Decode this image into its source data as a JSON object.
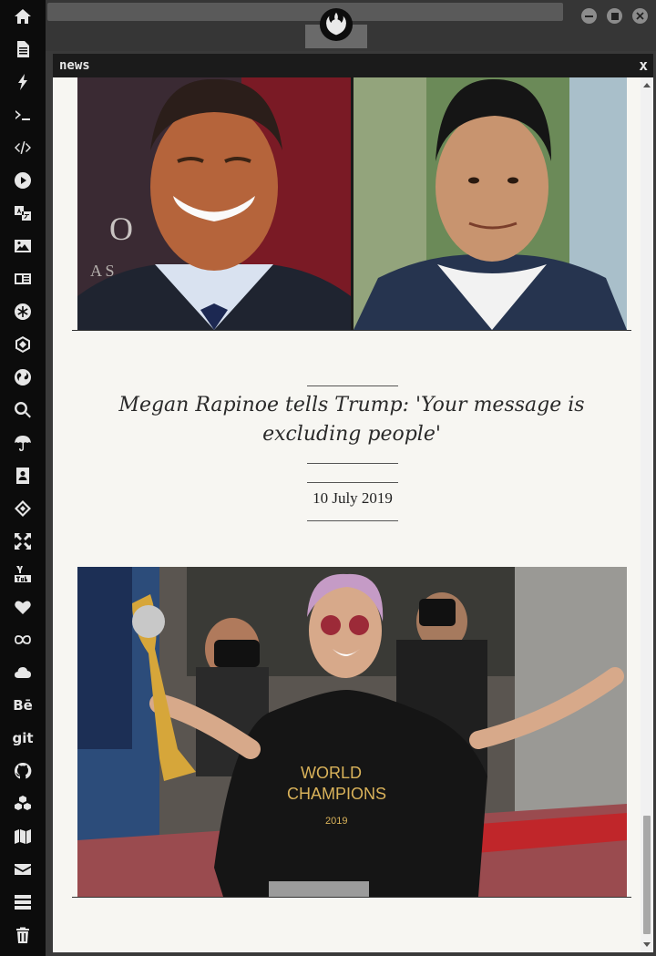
{
  "address_bar": {
    "value": ""
  },
  "window": {
    "title": "news",
    "close_label": "x"
  },
  "article": {
    "headline": "Megan Rapinoe tells Trump: 'Your message is excluding people'",
    "date": "10 July 2019"
  },
  "jersey": {
    "line1": "WORLD",
    "line2": "CHAMPIONS",
    "year": "2019"
  },
  "backdrop_letters": {
    "o": "O",
    "a": "A S"
  },
  "dock": {
    "behance_label": "Bē",
    "git_label": "git"
  },
  "colors": {
    "dock_bg": "#0c0c0c",
    "topbar_bg": "#363636",
    "window_bg": "#f7f6f2",
    "titlebar_bg": "#1b1b1b"
  }
}
